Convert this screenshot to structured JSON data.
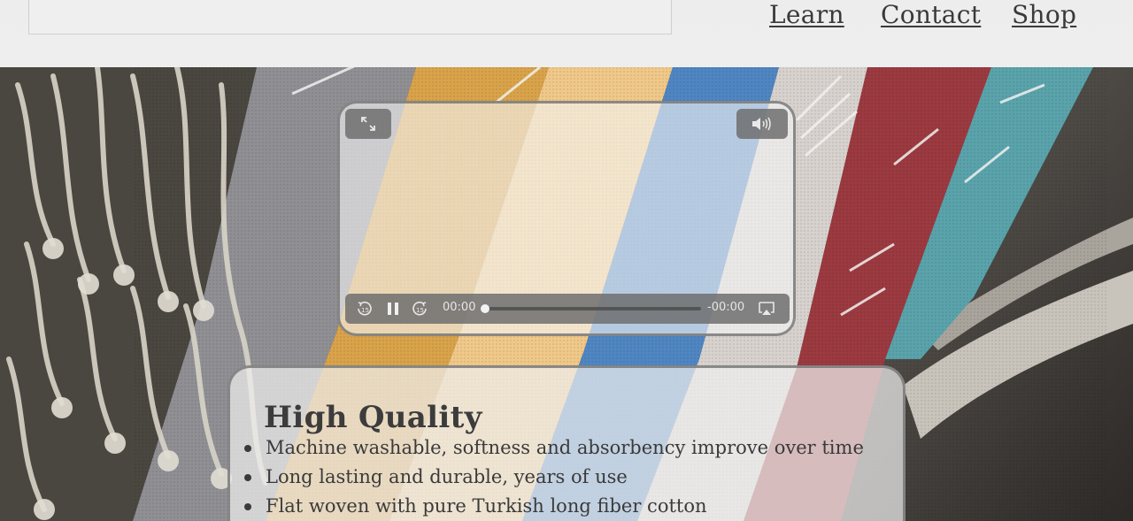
{
  "nav": {
    "links": [
      {
        "label": "Learn"
      },
      {
        "label": "Contact"
      },
      {
        "label": "Shop"
      }
    ]
  },
  "player": {
    "current_time": "00:00",
    "remaining_time": "-00:00",
    "progress": 0,
    "icons": {
      "fullscreen": "expand-icon",
      "volume": "volume-icon",
      "rewind": "rewind-15-icon",
      "pause": "pause-icon",
      "forward": "forward-15-icon",
      "airplay": "airplay-icon"
    }
  },
  "quality": {
    "title": "High Quality",
    "items": [
      "Machine washable, softness and absorbency improve over time",
      "Long lasting and durable, years of use",
      "Flat woven with pure Turkish long fiber cotton"
    ]
  },
  "colors": {
    "text": "#3a3a3a",
    "control_bg": "#6e6e6e"
  }
}
